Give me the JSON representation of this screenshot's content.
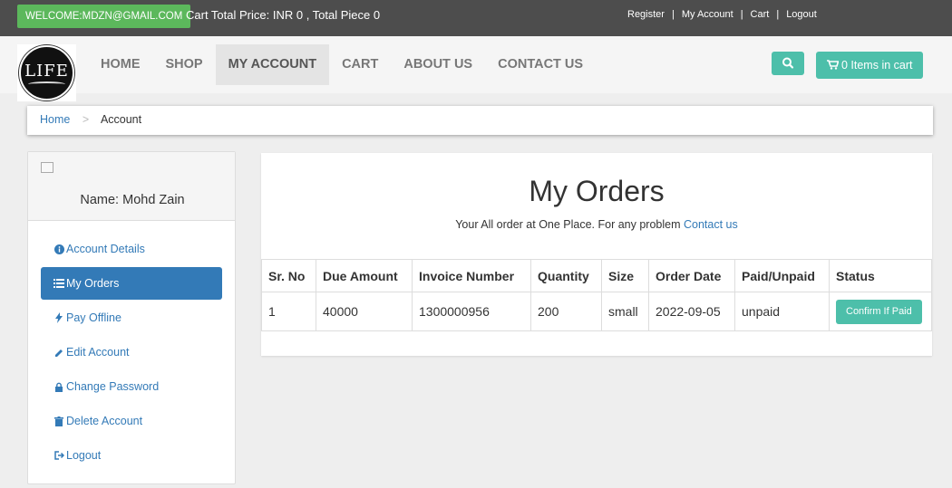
{
  "topbar": {
    "welcome": "WELCOME:MDZN@GMAIL.COM",
    "cart_info": "Cart Total Price: INR 0 , Total Piece 0",
    "links": [
      "Register",
      "My Account",
      "Cart",
      "Logout"
    ],
    "separator": "|"
  },
  "logo": {
    "text": "LIFE"
  },
  "nav": {
    "items": [
      "HOME",
      "SHOP",
      "MY ACCOUNT",
      "CART",
      "ABOUT US",
      "CONTACT US"
    ],
    "active": "MY ACCOUNT",
    "search_icon": "search-icon",
    "cart_label": "0 Items in cart",
    "cart_icon": "shopping-cart-icon"
  },
  "breadcrumb": {
    "home": "Home",
    "separator": ">",
    "current": "Account"
  },
  "sidebar": {
    "name": "Name: Mohd Zain",
    "items": [
      {
        "label": "Account Details",
        "icon": "info-icon"
      },
      {
        "label": "My Orders",
        "icon": "list-icon"
      },
      {
        "label": "Pay Offline",
        "icon": "bolt-icon"
      },
      {
        "label": "Edit Account",
        "icon": "pencil-icon"
      },
      {
        "label": "Change Password",
        "icon": "lock-icon"
      },
      {
        "label": "Delete Account",
        "icon": "trash-icon"
      },
      {
        "label": "Logout",
        "icon": "logout-icon"
      }
    ],
    "active_index": 1
  },
  "main": {
    "title": "My Orders",
    "subtitle": "Your All order at One Place. For any problem ",
    "contact_link": "Contact us",
    "columns": [
      "Sr. No",
      "Due Amount",
      "Invoice Number",
      "Quantity",
      "Size",
      "Order Date",
      "Paid/Unpaid",
      "Status"
    ],
    "rows": [
      {
        "sr": "1",
        "due": "40000",
        "invoice": "1300000956",
        "qty": "200",
        "size": "small",
        "date": "2022-09-05",
        "paid": "unpaid",
        "status_button": "Confirm If Paid"
      }
    ]
  },
  "colors": {
    "accent": "#4dbfaa",
    "primary": "#337ab7",
    "welcome": "#5cb85c",
    "topbar": "#4d4d4d"
  }
}
